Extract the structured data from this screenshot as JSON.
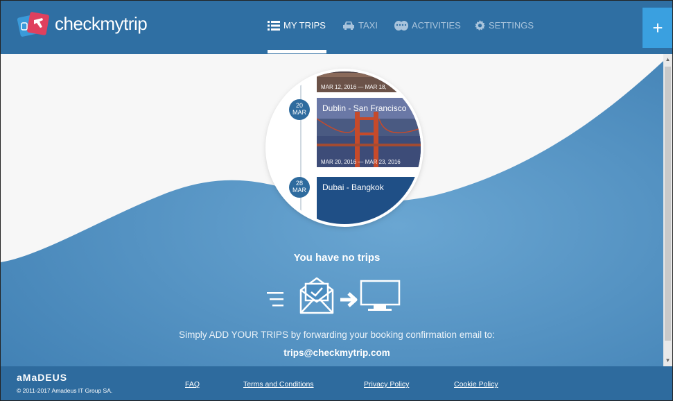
{
  "header": {
    "logo_text": "checkmytrip",
    "nav": [
      {
        "label": "MY TRIPS",
        "icon": "list-icon",
        "active": true
      },
      {
        "label": "TAXI",
        "icon": "car-icon",
        "active": false
      },
      {
        "label": "ACTIVITIES",
        "icon": "theater-masks-icon",
        "active": false
      },
      {
        "label": "SETTINGS",
        "icon": "gear-icon",
        "active": false
      }
    ],
    "add_label": "+"
  },
  "illustration": {
    "trips": [
      {
        "dates": "MAR 12, 2016 — MAR 18,"
      },
      {
        "day": "20",
        "month": "MAR",
        "title": "Dublin - San Francisco",
        "dates": "MAR 20, 2016 — MAR 23, 2016"
      },
      {
        "day": "28",
        "month": "MAR",
        "title": "Dubai - Bangkok"
      }
    ]
  },
  "main": {
    "no_trips": "You have no trips",
    "instructions": "Simply ADD YOUR TRIPS by forwarding your booking confirmation email to:",
    "email": "trips@checkmytrip.com"
  },
  "footer": {
    "brand": "aMaDEUS",
    "copyright": "© 2011-2017 Amadeus IT Group SA.",
    "links": [
      "FAQ",
      "Terms and Conditions",
      "Privacy Policy",
      "Cookie Policy"
    ]
  },
  "colors": {
    "header_bg": "#2f6fa3",
    "accent": "#3aa0e0",
    "footer_bg": "#2e6b9e",
    "wave_blue": "#4a8cc0"
  }
}
